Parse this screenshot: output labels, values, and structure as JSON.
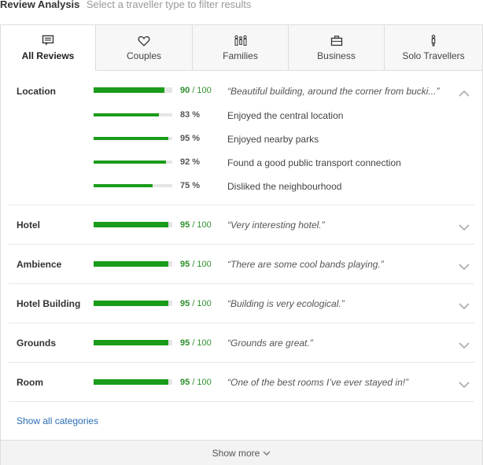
{
  "header": {
    "title": "Review Analysis",
    "subtitle": "Select a traveller type to filter results"
  },
  "tabs": [
    {
      "label": "All Reviews",
      "icon": "speech-bubble-icon",
      "active": true
    },
    {
      "label": "Couples",
      "icon": "heart-icon",
      "active": false
    },
    {
      "label": "Families",
      "icon": "family-icon",
      "active": false
    },
    {
      "label": "Business",
      "icon": "briefcase-icon",
      "active": false
    },
    {
      "label": "Solo Travellers",
      "icon": "person-icon",
      "active": false
    }
  ],
  "categories": [
    {
      "name": "Location",
      "score": "90",
      "out_of": "/ 100",
      "score_value": 90,
      "quote": "“Beautiful building, around the corner from bucki...”",
      "expanded": true,
      "subitems": [
        {
          "percent": "83 %",
          "value": 83,
          "text": "Enjoyed the central location"
        },
        {
          "percent": "95 %",
          "value": 95,
          "text": "Enjoyed nearby parks"
        },
        {
          "percent": "92 %",
          "value": 92,
          "text": "Found a good public transport connection"
        },
        {
          "percent": "75 %",
          "value": 75,
          "text": "Disliked the neighbourhood"
        }
      ]
    },
    {
      "name": "Hotel",
      "score": "95",
      "out_of": "/ 100",
      "score_value": 95,
      "quote": "“Very interesting hotel.”",
      "expanded": false
    },
    {
      "name": "Ambience",
      "score": "95",
      "out_of": "/ 100",
      "score_value": 95,
      "quote": "“There are some cool bands playing.”",
      "expanded": false
    },
    {
      "name": "Hotel Building",
      "score": "95",
      "out_of": "/ 100",
      "score_value": 95,
      "quote": "“Building is very ecological.”",
      "expanded": false
    },
    {
      "name": "Grounds",
      "score": "95",
      "out_of": "/ 100",
      "score_value": 95,
      "quote": "“Grounds are great.”",
      "expanded": false
    },
    {
      "name": "Room",
      "score": "95",
      "out_of": "/ 100",
      "score_value": 95,
      "quote": "“One of the best rooms I’ve ever stayed in!”",
      "expanded": false
    }
  ],
  "show_all_label": "Show all categories",
  "show_more_label": "Show more",
  "colors": {
    "score_green": "#1a9c1a",
    "link_blue": "#2a6db5"
  }
}
